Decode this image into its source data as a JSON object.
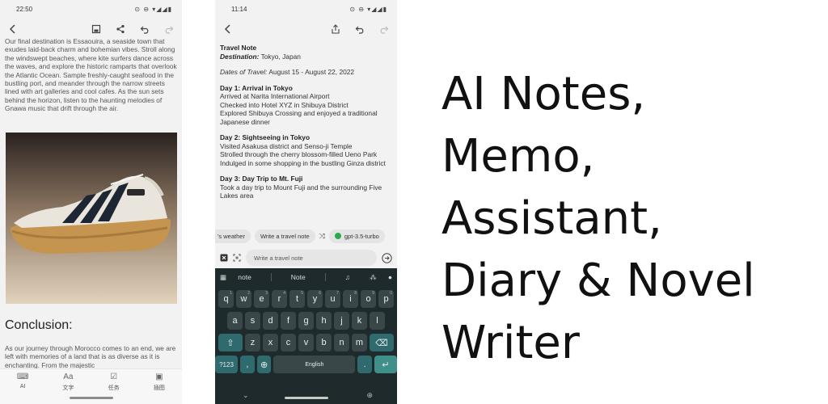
{
  "left_phone": {
    "status_time": "22:50",
    "body_text": "Our final destination is Essaouira, a seaside town that exudes laid-back charm and bohemian vibes. Stroll along the windswept beaches, where kite surfers dance across the waves, and explore the historic ramparts that overlook the Atlantic Ocean. Sample freshly-caught seafood in the bustling port, and meander through the narrow streets lined with art galleries and cool cafes. As the sun sets behind the horizon, listen to the haunting melodies of Gnawa music that drift through the air.",
    "heading": "Conclusion:",
    "conclusion_text": "As our journey through Morocco comes to an end, we are left with memories of a land that is as diverse as it is enchanting. From the majestic",
    "nav": [
      {
        "label": "AI",
        "icon": "ai-icon",
        "glyph": "⌨"
      },
      {
        "label": "文字",
        "icon": "text-icon",
        "glyph": "Aa"
      },
      {
        "label": "任务",
        "icon": "task-icon",
        "glyph": "☑"
      },
      {
        "label": "插图",
        "icon": "image-icon",
        "glyph": "▣"
      }
    ]
  },
  "right_phone": {
    "status_time": "11:14",
    "note": {
      "title": "Travel Note",
      "destination_label": "Destination:",
      "destination_value": "Tokyo, Japan",
      "dates_label": "Dates of Travel:",
      "dates_value": "August 15 - August 22, 2022",
      "days": [
        {
          "title": "Day 1: Arrival in Tokyo",
          "lines": [
            "Arrived at Narita International Airport",
            "Checked into Hotel XYZ in Shibuya District",
            "Explored Shibuya Crossing and enjoyed a traditional Japanese dinner"
          ]
        },
        {
          "title": "Day 2: Sightseeing in Tokyo",
          "lines": [
            "Visited Asakusa district and Senso-ji Temple",
            "Strolled through the cherry blossom-filled Ueno Park",
            "Indulged in some shopping in the bustling Ginza district"
          ]
        },
        {
          "title": "Day 3: Day Trip to Mt. Fuji",
          "lines": [
            "Took a day trip to Mount Fuji and the surrounding Five Lakes area"
          ]
        }
      ]
    },
    "chips": {
      "chip1": "'s weather",
      "chip2": "Write a travel note",
      "chip3": "gpt-3.5-turbo"
    },
    "input_value": "Write a travel note",
    "keyboard": {
      "suggestions": [
        "note",
        "Note"
      ],
      "row1": [
        "q",
        "w",
        "e",
        "r",
        "t",
        "y",
        "u",
        "i",
        "o",
        "p"
      ],
      "row1_hints": [
        "1",
        "2",
        "3",
        "4",
        "5",
        "6",
        "7",
        "8",
        "9",
        "0"
      ],
      "row2": [
        "a",
        "s",
        "d",
        "f",
        "g",
        "h",
        "j",
        "k",
        "l"
      ],
      "row3": [
        "z",
        "x",
        "c",
        "v",
        "b",
        "n",
        "m"
      ],
      "sym_key": "?123",
      "comma": ",",
      "space": "English",
      "period": "."
    }
  },
  "tagline": [
    "AI Notes,",
    "Memo,",
    "Assistant,",
    "Diary & Novel",
    "Writer"
  ]
}
